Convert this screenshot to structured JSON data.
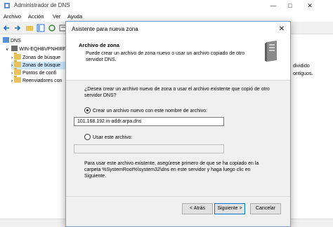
{
  "app": {
    "title": "Administrador de DNS",
    "menu": [
      "Archivo",
      "Acción",
      "Ver",
      "Ayuda"
    ]
  },
  "tree": {
    "root": "DNS",
    "server": "WIN-EQHBVPNHIRF",
    "items": [
      "Zonas de búsque",
      "Zonas de búsque",
      "Puntos de confi",
      "Reenviadores con"
    ]
  },
  "background_text": {
    "line1": "dividido",
    "line2": "ontiguos."
  },
  "dialog": {
    "title": "Asistente para nueva zona",
    "close": "✕",
    "header_title": "Archivo de zona",
    "header_desc": "Puede crear un archivo de zona nuevo o usar un archivo copiado de otro servidor DNS.",
    "question": "¿Desea crear un archivo nuevo de zona o usar el archivo existente que copió de otro servidor DNS?",
    "option_new_label": "Crear un archivo nuevo con este nombre de archivo:",
    "option_new_value": "101.168.192.in-addr.arpa.dns",
    "option_existing_label": "Usar este archivo:",
    "option_existing_value": "",
    "note": "Para usar este archivo existente, asegúrese primero de que se ha copiado en la carpeta %SystemRoot%\\system32\\dns en este servidor y haga luego clic en Siguiente.",
    "selected_option": "new",
    "buttons": {
      "back": "< Atrás",
      "next": "Siguiente >",
      "cancel": "Cancelar"
    }
  },
  "colors": {
    "accent": "#0078d7",
    "folder": "#e8c25a",
    "selection": "#cce8ff"
  }
}
